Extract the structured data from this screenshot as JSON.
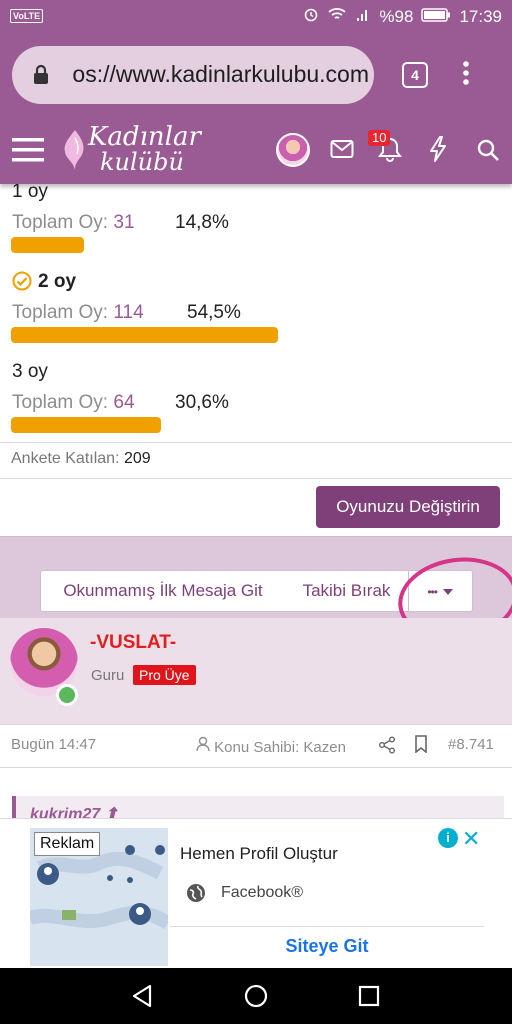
{
  "status": {
    "network": "VoLTE",
    "battery": "%98",
    "time": "17:39"
  },
  "browser": {
    "url": "os://www.kadinlarkulubu.com",
    "tab_count": "4"
  },
  "site": {
    "logo_line1": "Kadınlar",
    "logo_line2": "kulübü",
    "notification_count": "10"
  },
  "poll": {
    "options": [
      {
        "label": "1 oy",
        "votes_label": "Toplam Oy:",
        "votes": "31",
        "percent": "14,8%",
        "fraction": 0.148,
        "selected": false
      },
      {
        "label": "2 oy",
        "votes_label": "Toplam Oy:",
        "votes": "114",
        "percent": "54,5%",
        "fraction": 0.545,
        "selected": true
      },
      {
        "label": "3 oy",
        "votes_label": "Toplam Oy:",
        "votes": "64",
        "percent": "30,6%",
        "fraction": 0.306,
        "selected": false
      }
    ],
    "participants_label": "Ankete Katılan:",
    "participants": "209",
    "change_vote": "Oyunuzu Değiştirin",
    "bar_color": "#f0a000"
  },
  "thread_actions": {
    "first_unread": "Okunmamış İlk Mesaja Git",
    "unfollow": "Takibi Bırak",
    "more": "•••"
  },
  "post": {
    "username": "-VUSLAT-",
    "rank": "Guru",
    "badge": "Pro Üye",
    "date": "Bugün 14:47",
    "author_label": "Konu Sahibi: Kazen",
    "number": "#8.741",
    "quote_user": "kukrim27 ⬆"
  },
  "ad": {
    "label": "Reklam",
    "title": "Hemen Profil Oluştur",
    "source": "Facebook®",
    "cta": "Siteye Git"
  },
  "colors": {
    "brand": "#9a5a93",
    "accent": "#7f3f79",
    "bar": "#f0a000",
    "badge": "#e2141b"
  }
}
